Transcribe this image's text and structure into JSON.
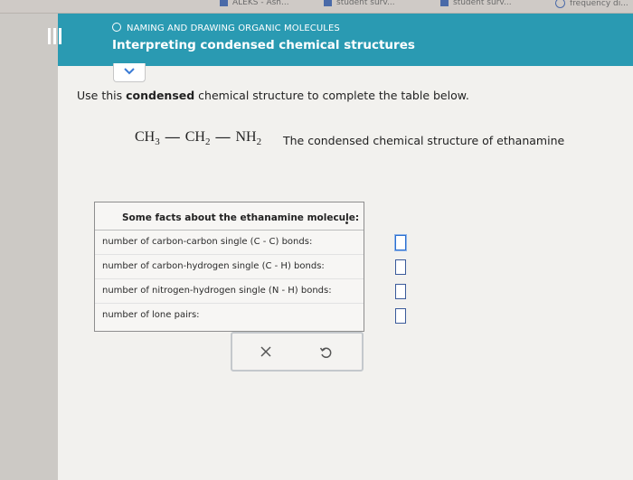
{
  "browser_tabs": [
    {
      "label": "ALEKS - Ash...",
      "kind": "box"
    },
    {
      "label": "student surv...",
      "kind": "box"
    },
    {
      "label": "student surv...",
      "kind": "box"
    },
    {
      "label": "frequency di...",
      "kind": "circle"
    }
  ],
  "header": {
    "topic": "NAMING AND DRAWING ORGANIC MOLECULES",
    "subtitle": "Interpreting condensed chemical structures"
  },
  "instruction": {
    "prefix": "Use this ",
    "bold": "condensed",
    "suffix": " chemical structure to complete the table below."
  },
  "formula": {
    "g1": "CH",
    "g1_sub": "3",
    "g2": "CH",
    "g2_sub": "2",
    "g3": "NH",
    "g3_sub": "2",
    "bond": "—"
  },
  "caption": "The condensed chemical structure of ethanamine",
  "facts": {
    "header": "Some facts about the ethanamine molecule:",
    "rows": [
      {
        "label": "number of carbon-carbon single (C - C) bonds:",
        "value": ""
      },
      {
        "label": "number of carbon-hydrogen single (C - H) bonds:",
        "value": ""
      },
      {
        "label": "number of nitrogen-hydrogen single (N - H) bonds:",
        "value": ""
      },
      {
        "label": "number of lone pairs:",
        "value": ""
      }
    ]
  },
  "actions": {
    "clear_icon": "x-icon",
    "undo_icon": "undo-icon"
  },
  "colors": {
    "header_bg": "#2a9ab2",
    "accent": "#3a5a9a"
  }
}
